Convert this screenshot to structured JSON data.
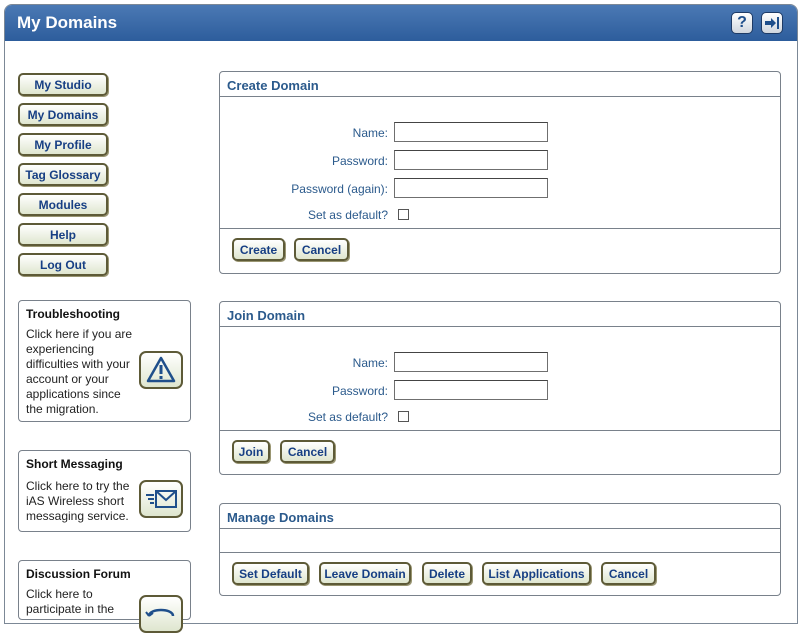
{
  "window": {
    "title": "My Domains"
  },
  "titlebar_buttons": {
    "help_icon": "question-icon",
    "exit_icon": "exit-icon"
  },
  "nav": {
    "items": [
      {
        "label": "My Studio"
      },
      {
        "label": "My Domains"
      },
      {
        "label": "My Profile"
      },
      {
        "label": "Tag Glossary"
      },
      {
        "label": "Modules"
      },
      {
        "label": "Help"
      },
      {
        "label": "Log Out"
      }
    ]
  },
  "info_boxes": [
    {
      "title": "Troubleshooting",
      "lines": [
        "Click here if you are",
        "experiencing",
        "difficulties with your",
        "account or your",
        "applications since",
        "the migration."
      ],
      "icon": "warning-icon"
    },
    {
      "title": "Short Messaging",
      "lines": [
        "Click here to try the",
        "iAS Wireless short",
        "messaging service."
      ],
      "icon": "envelope-icon"
    },
    {
      "title": "Discussion Forum",
      "lines": [
        "Click here to",
        "participate in the"
      ],
      "icon": "forum-icon"
    }
  ],
  "create_domain": {
    "title": "Create Domain",
    "name_label": "Name:",
    "password_label": "Password:",
    "password_again_label": "Password (again):",
    "default_label": "Set as default?",
    "name_value": "",
    "password_value": "",
    "password_again_value": "",
    "default_checked": false,
    "create_button": "Create",
    "cancel_button": "Cancel"
  },
  "join_domain": {
    "title": "Join Domain",
    "name_label": "Name:",
    "password_label": "Password:",
    "default_label": "Set as default?",
    "name_value": "",
    "password_value": "",
    "default_checked": false,
    "join_button": "Join",
    "cancel_button": "Cancel"
  },
  "manage_domains": {
    "title": "Manage Domains",
    "buttons": {
      "set_default": "Set Default",
      "leave_domain": "Leave Domain",
      "delete": "Delete",
      "list_applications": "List Applications",
      "cancel": "Cancel"
    }
  },
  "colors": {
    "titlebar": "#2d5d9c",
    "label_text": "#2b5a8c",
    "button_text": "#173f84"
  }
}
